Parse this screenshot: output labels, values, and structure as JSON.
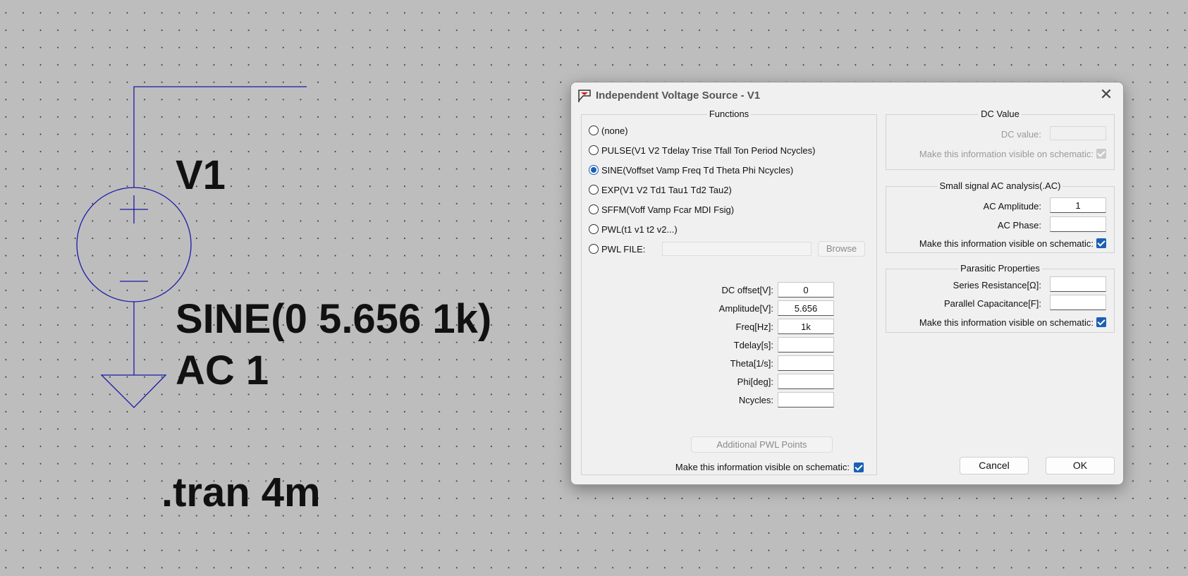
{
  "schematic": {
    "component_name": "V1",
    "value_line1": "SINE(0 5.656 1k)",
    "value_line2": "AC 1",
    "directive": ".tran 4m"
  },
  "dialog": {
    "title": "Independent Voltage Source - V1",
    "close_glyph": "✕",
    "functions": {
      "title": "Functions",
      "options": [
        {
          "label": "(none)",
          "selected": false
        },
        {
          "label": "PULSE(V1 V2 Tdelay Trise Tfall Ton Period Ncycles)",
          "selected": false
        },
        {
          "label": "SINE(Voffset Vamp Freq Td Theta Phi Ncycles)",
          "selected": true
        },
        {
          "label": "EXP(V1 V2 Td1 Tau1 Td2 Tau2)",
          "selected": false
        },
        {
          "label": "SFFM(Voff Vamp Fcar MDI Fsig)",
          "selected": false
        },
        {
          "label": "PWL(t1 v1 t2 v2...)",
          "selected": false
        },
        {
          "label": "PWL FILE:",
          "selected": false
        }
      ],
      "browse_label": "Browse",
      "pwl_file_value": "",
      "params": [
        {
          "label": "DC offset[V]:",
          "value": "0"
        },
        {
          "label": "Amplitude[V]:",
          "value": "5.656"
        },
        {
          "label": "Freq[Hz]:",
          "value": "1k"
        },
        {
          "label": "Tdelay[s]:",
          "value": ""
        },
        {
          "label": "Theta[1/s]:",
          "value": ""
        },
        {
          "label": "Phi[deg]:",
          "value": ""
        },
        {
          "label": "Ncycles:",
          "value": ""
        }
      ],
      "additional_pwl_label": "Additional PWL Points",
      "visible_label": "Make this information visible on schematic:",
      "visible_checked": true
    },
    "dc_value": {
      "title": "DC Value",
      "label": "DC value:",
      "value": "",
      "visible_label": "Make this information visible on schematic:",
      "visible_checked": true
    },
    "ac": {
      "title": "Small signal AC analysis(.AC)",
      "amplitude_label": "AC Amplitude:",
      "amplitude_value": "1",
      "phase_label": "AC Phase:",
      "phase_value": "",
      "visible_label": "Make this information visible on schematic:",
      "visible_checked": true
    },
    "parasitic": {
      "title": "Parasitic Properties",
      "series_label": "Series Resistance[Ω]:",
      "series_value": "",
      "parallel_label": "Parallel Capacitance[F]:",
      "parallel_value": "",
      "visible_label": "Make this information visible on schematic:",
      "visible_checked": true
    },
    "cancel_label": "Cancel",
    "ok_label": "OK"
  },
  "annotation": {
    "arrow_color": "#e8221e"
  },
  "colors": {
    "wire": "#1a1aaa",
    "canvas": "#bdbdbd",
    "accent": "#1a5fb4"
  }
}
